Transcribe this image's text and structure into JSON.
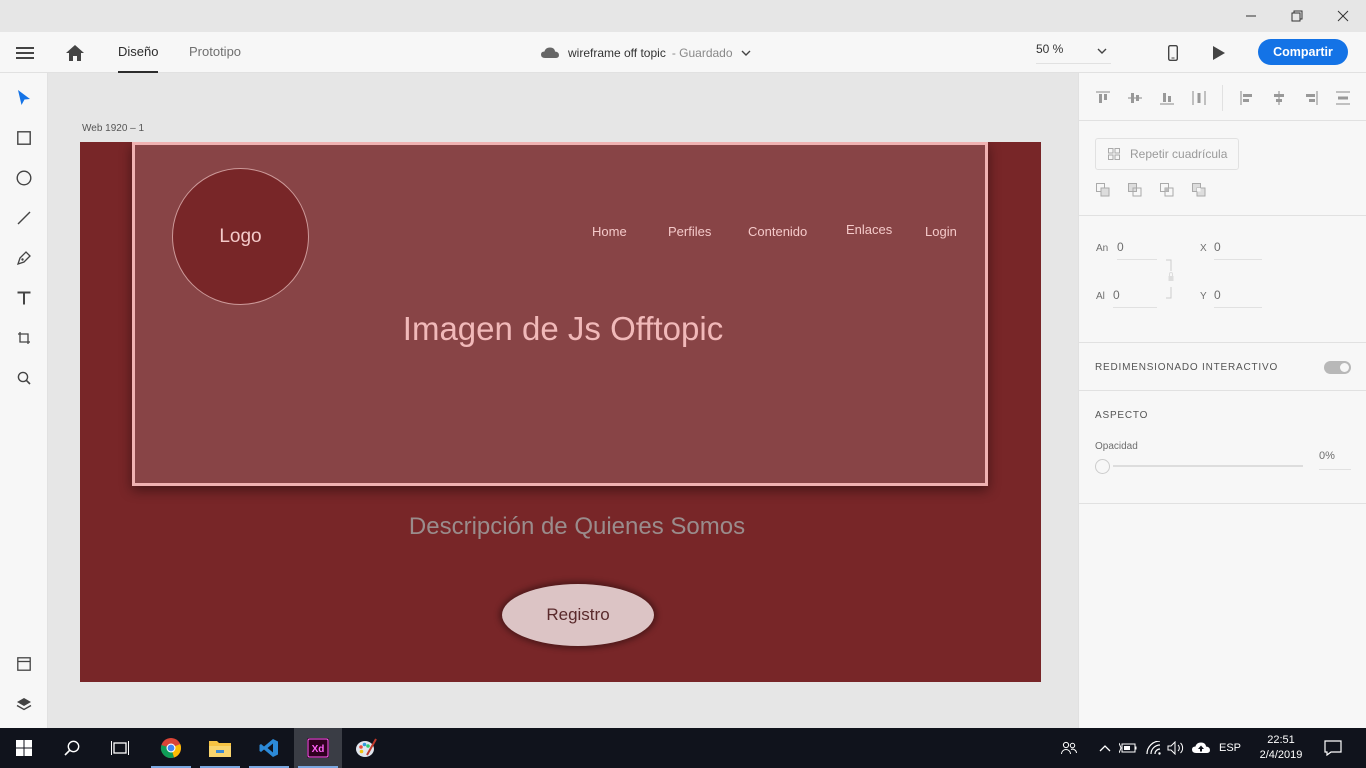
{
  "header": {
    "tabs": [
      {
        "label": "Diseño",
        "active": true
      },
      {
        "label": "Prototipo",
        "active": false
      }
    ],
    "document_name": "wireframe off topic",
    "save_status": "- Guardado",
    "zoom": "50 %",
    "share_label": "Compartir"
  },
  "canvas": {
    "artboard_name": "Web 1920 – 1",
    "logo_text": "Logo",
    "nav": [
      "Home",
      "Perfiles",
      "Contenido",
      "Enlaces",
      "Login"
    ],
    "hero_title": "Imagen de Js Offtopic",
    "description": "Descripción de Quienes Somos",
    "button_label": "Registro"
  },
  "panel": {
    "repeat_grid_label": "Repetir cuadrícula",
    "width_label": "An",
    "width_value": "0",
    "height_label": "Al",
    "height_value": "0",
    "x_label": "X",
    "x_value": "0",
    "y_label": "Y",
    "y_value": "0",
    "responsive_label": "REDIMENSIONADO INTERACTIVO",
    "appearance_label": "ASPECTO",
    "opacity_label": "Opacidad",
    "opacity_value": "0%"
  },
  "taskbar": {
    "language": "ESP",
    "time": "22:51",
    "date": "2/4/2019"
  },
  "colors": {
    "artboard_bg": "#782628",
    "hero_bg": "#884446",
    "hero_border": "#f0b2b2",
    "accent_blue": "#1473e6"
  }
}
